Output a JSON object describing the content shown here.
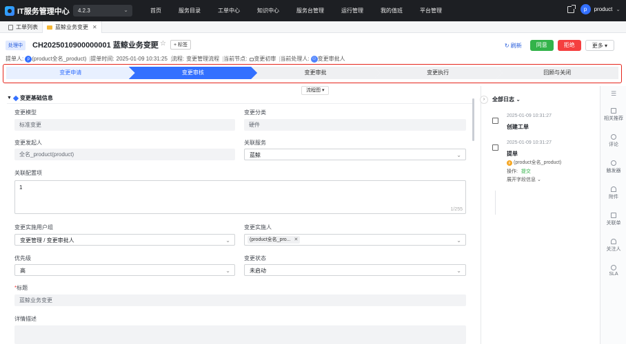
{
  "topbar": {
    "app_title": "IT服务管理中心",
    "version": "4.2.3",
    "nav": [
      "首页",
      "服务目录",
      "工单中心",
      "知识中心",
      "服务台管理",
      "运行管理",
      "我的值班",
      "平台管理"
    ],
    "user_initial": "p",
    "user_name": "product"
  },
  "tabs": [
    {
      "label": "工单列表"
    },
    {
      "label": "蓝鲸业务变更"
    }
  ],
  "ticket": {
    "status": "处理中",
    "title": "CH2025010900000001 蓝鲸业务变更",
    "tag_button": "+ 标签",
    "meta": {
      "submitter_label": "提单人:",
      "submitter": "(product全名_product)",
      "submit_time_label": "提单时间:",
      "submit_time": "2025-01-09 10:31:25",
      "flow_label": "流程:",
      "flow": "变更管理流程",
      "node_label": "当前节点:",
      "node": "变更初审",
      "handler_label": "当前处理人:",
      "handler": "变更审批人"
    },
    "actions": {
      "refresh": "刷新",
      "approve": "同意",
      "reject": "拒绝",
      "more": "更多"
    }
  },
  "steps": [
    {
      "label": "变更申请",
      "state": "done"
    },
    {
      "label": "变更审核",
      "state": "current"
    },
    {
      "label": "变更审批",
      "state": "todo"
    },
    {
      "label": "变更执行",
      "state": "todo"
    },
    {
      "label": "回顾与关闭",
      "state": "todo"
    }
  ],
  "flow_chart_button": "流程图",
  "form": {
    "section_title": "变更基础信息",
    "change_model_label": "变更模型",
    "change_model": "标准变更",
    "change_category_label": "变更分类",
    "change_category": "硬件",
    "initiator_label": "变更发起人",
    "initiator": "全名_product(product)",
    "service_label": "关联服务",
    "service": "蓝鲸",
    "config_label": "关联配置项",
    "config_value": "1",
    "config_count": "1/255",
    "group_label": "变更实施用户组",
    "group": "变更管理 / 变更审批人",
    "implementer_label": "变更实施人",
    "implementer_chip": "(product全名_pro...",
    "priority_label": "优先级",
    "priority": "高",
    "state_label": "变更状态",
    "state": "未启动",
    "title_label": "标题",
    "title_value": "蓝鲸业务变更",
    "desc_label": "详情描述"
  },
  "log": {
    "title": "全部日志",
    "items": [
      {
        "time": "2025-01-09 10:31:27",
        "action": "创建工单"
      },
      {
        "time": "2025-01-09 10:31:27",
        "action": "提单",
        "user": "(product全名_product)",
        "op_label": "操作:",
        "op": "提交",
        "expand": "展开字段信息"
      }
    ]
  },
  "rail": [
    "相关推荐",
    "评论",
    "触发器",
    "附件",
    "关联单",
    "关注人",
    "SLA"
  ],
  "colors": {
    "step_current": "#3370ff",
    "step_done": "#e8f0ff",
    "step_todo": "#eff0f2",
    "approve": "#33b34a",
    "reject": "#f53f3f",
    "highlight_border": "#e5231a"
  }
}
